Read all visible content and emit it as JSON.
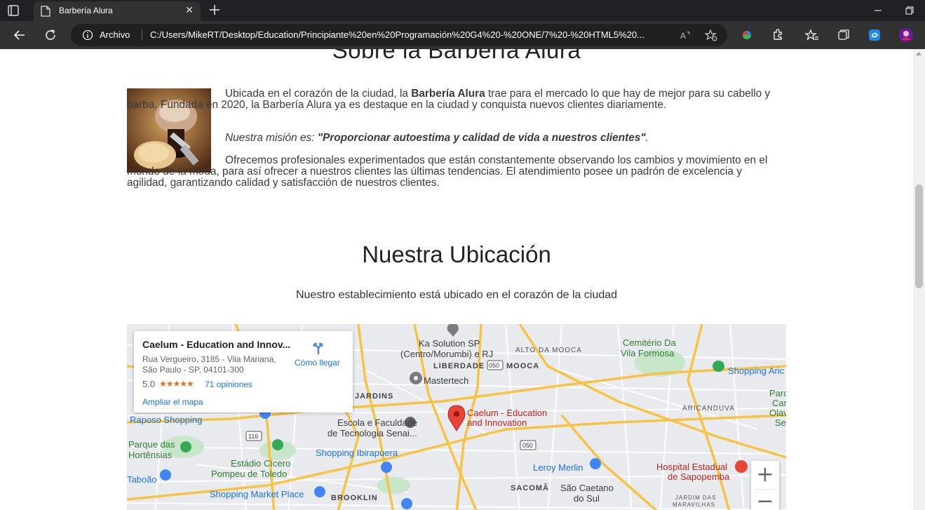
{
  "browser": {
    "tab_title": "Barbería Alura",
    "tab_close": "✕",
    "address_label": "Archivo",
    "url": "C:/Users/MikeRT/Desktop/Education/Principiante%20en%20Programación%20G4%20-%20ONE/7%20-%20HTML5%20..."
  },
  "about": {
    "title": "Sobre la Barbería Alura",
    "p1_before": "Ubicada en el corazón de la ciudad, la ",
    "p1_bold": "Barbería Alura",
    "p1_after": " trae para el mercado lo que hay de mejor para su cabello y barba. Fundada en 2020, la Barbería Alura ya es destaque en la ciudad y conquista nuevos clientes diariamente.",
    "p2_before": "Nuestra misión es: ",
    "p2_bold": "\"Proporcionar autoestima y calidad de vida a nuestros clientes\"",
    "p2_after": ".",
    "p3": "Ofrecemos profesionales experimentados que están constantemente observando los cambios y movimiento en el mundo de la moda, para así ofrecer a nuestros clientes las últimas tendencias. El atendimiento posee un padrón de excelencia y agilidad, garantizando calidad y satisfacción de nuestros clientes."
  },
  "location": {
    "title": "Nuestra Ubicación",
    "subtitle": "Nuestro establecimiento está ubicado en el corazón de la ciudad"
  },
  "map": {
    "place_name": "Caelum - Education and Innov...",
    "address_line1": "Rua Vergueiro, 3185 - Vila Mariana,",
    "address_line2": "São Paulo - SP, 04101-300",
    "rating": "5.0",
    "stars": "★★★★★",
    "reviews": "71 opiniones",
    "enlarge": "Ampliar el mapa",
    "directions": "Cómo llegar",
    "zoom_in": "+",
    "zoom_out": "−",
    "labels": {
      "ka_solution_1": "Ka Solution SP",
      "ka_solution_2": "(Centro/Morumbi) e RJ",
      "alto_mooca": "ALTO DA MOOCA",
      "liberdade": "LIBERDADE",
      "road_050a": "050",
      "mooca": "MOOCA",
      "cemiterio_1": "Cemitério Da",
      "cemiterio_2": "Vila Formosa",
      "shopping_aric": "Shopping Aric",
      "mastertech": "Mastertech",
      "jardins": "JARDINS",
      "caelum_1": "Caelum - Education",
      "caelum_2": "and Innovation",
      "parq_1": "Parc",
      "parq_2": "Car",
      "parq_3": "Olavo",
      "parq_4": "Se",
      "aricanduva": "ARICANDUVA",
      "raposo": "Raposo Shopping",
      "escola_1": "Escola e Faculdade",
      "escola_2": "de Tecnologia Senai...",
      "road_116": "116",
      "road_050b": "050",
      "parque_1": "Parque das",
      "parque_2": "Hortênsias",
      "shopping_ibira": "Shopping Ibirapuera",
      "estadio_1": "Estádio Cícero",
      "estadio_2": "Pompeu de Toledo",
      "leroy": "Leroy Merlin",
      "hospital_1": "Hospital Estadual",
      "hospital_2": "de Sapopemba",
      "taboao": "Taboão",
      "sacoma": "SACOMÃ",
      "sao_caetano_1": "São Caetano",
      "sao_caetano_2": "do Sul",
      "jardim_1": "JARDIM DAS",
      "jardim_2": "MARAVILHAS",
      "shopping_market": "Shopping Market Place",
      "brooklin": "BROOKLIN"
    }
  },
  "colors": {
    "chrome_dark": "#202124",
    "chrome_bar": "#323232",
    "map_road": "#f6c344",
    "map_land": "#e8eaed",
    "map_park": "#c8e6c9",
    "link_blue": "#1a73e8",
    "pin_red": "#ea4335"
  }
}
